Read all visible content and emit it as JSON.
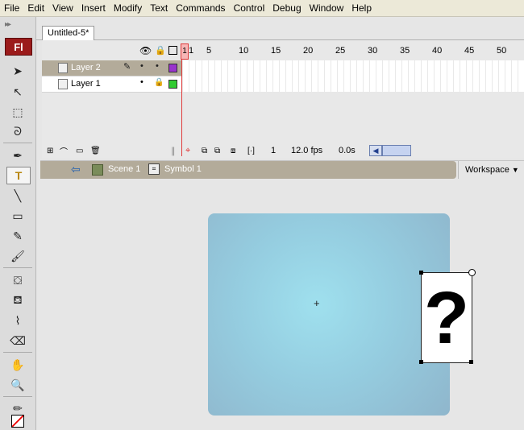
{
  "menu": [
    "File",
    "Edit",
    "View",
    "Insert",
    "Modify",
    "Text",
    "Commands",
    "Control",
    "Debug",
    "Window",
    "Help"
  ],
  "app_logo": "Fl",
  "document_tab": "Untitled-5*",
  "timeline": {
    "frame_numbers": [
      "1",
      "5",
      "10",
      "15",
      "20",
      "25",
      "30",
      "35",
      "40",
      "45",
      "50"
    ],
    "layers": [
      {
        "name": "Layer 2",
        "color": "#9933cc",
        "selected": true
      },
      {
        "name": "Layer 1",
        "color": "#33cc33",
        "selected": false
      }
    ],
    "current_frame": "1",
    "fps": "12.0 fps",
    "elapsed": "0.0s"
  },
  "editbar": {
    "scene": "Scene 1",
    "symbol": "Symbol 1",
    "workspace": "Workspace"
  },
  "stage": {
    "placeholder_glyph": "?",
    "registration_glyph": "+"
  }
}
